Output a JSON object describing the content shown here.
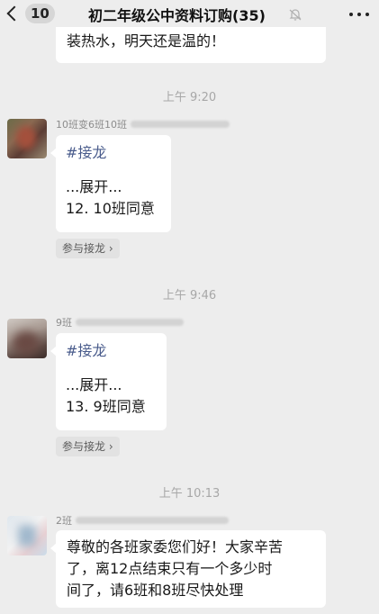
{
  "header": {
    "unread_count": "10",
    "title": "初二年级公中资料订购(35)"
  },
  "messages": {
    "top_snippet": "装热水，明天还是温的！",
    "time1": "上午 9:20",
    "m1": {
      "sender": "10班变6班10班",
      "tag": "#接龙",
      "expand": "...展开...",
      "text": "12. 10班同意",
      "join": "参与接龙 ›"
    },
    "time2": "上午 9:46",
    "m2": {
      "sender": "9班",
      "tag": "#接龙",
      "expand": "...展开...",
      "text": "13. 9班同意",
      "join": "参与接龙 ›"
    },
    "time3": "上午 10:13",
    "m3": {
      "sender": "2班",
      "line1": "尊敬的各班家委您们好！大家辛苦",
      "line2": "了，离12点结束只有一个多少时",
      "line3": "间了，请6班和8班尽快处理"
    }
  }
}
